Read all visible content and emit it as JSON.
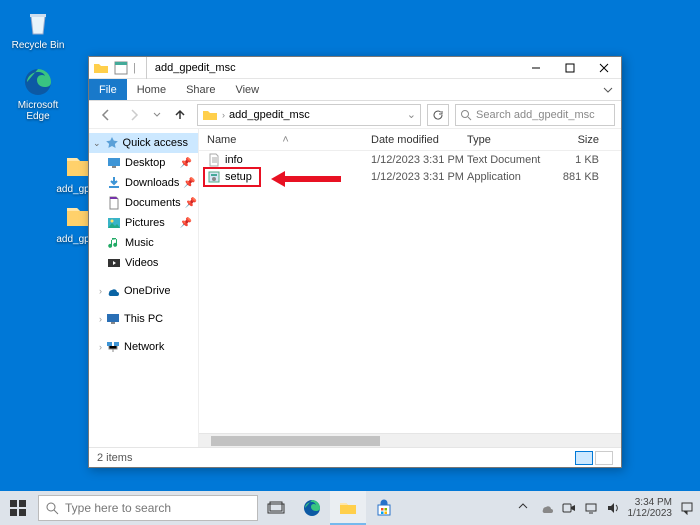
{
  "desktop": {
    "recycle": "Recycle Bin",
    "edge": "Microsoft\nEdge",
    "folder1": "add_gpe...",
    "folder2": "add_gpe..."
  },
  "explorer": {
    "title": "add_gpedit_msc",
    "tabs": {
      "file": "File",
      "home": "Home",
      "share": "Share",
      "view": "View"
    },
    "breadcrumb": "add_gpedit_msc",
    "search_placeholder": "Search add_gpedit_msc",
    "columns": {
      "name": "Name",
      "date": "Date modified",
      "type": "Type",
      "size": "Size"
    },
    "nav": {
      "quick_access": "Quick access",
      "desktop": "Desktop",
      "downloads": "Downloads",
      "documents": "Documents",
      "pictures": "Pictures",
      "music": "Music",
      "videos": "Videos",
      "onedrive": "OneDrive",
      "this_pc": "This PC",
      "network": "Network"
    },
    "rows": [
      {
        "name": "info",
        "date": "1/12/2023 3:31 PM",
        "type": "Text Document",
        "size": "1 KB"
      },
      {
        "name": "setup",
        "date": "1/12/2023 3:31 PM",
        "type": "Application",
        "size": "881 KB"
      }
    ],
    "status": "2 items"
  },
  "taskbar": {
    "search_placeholder": "Type here to search",
    "time": "3:34 PM",
    "date": "1/12/2023"
  }
}
